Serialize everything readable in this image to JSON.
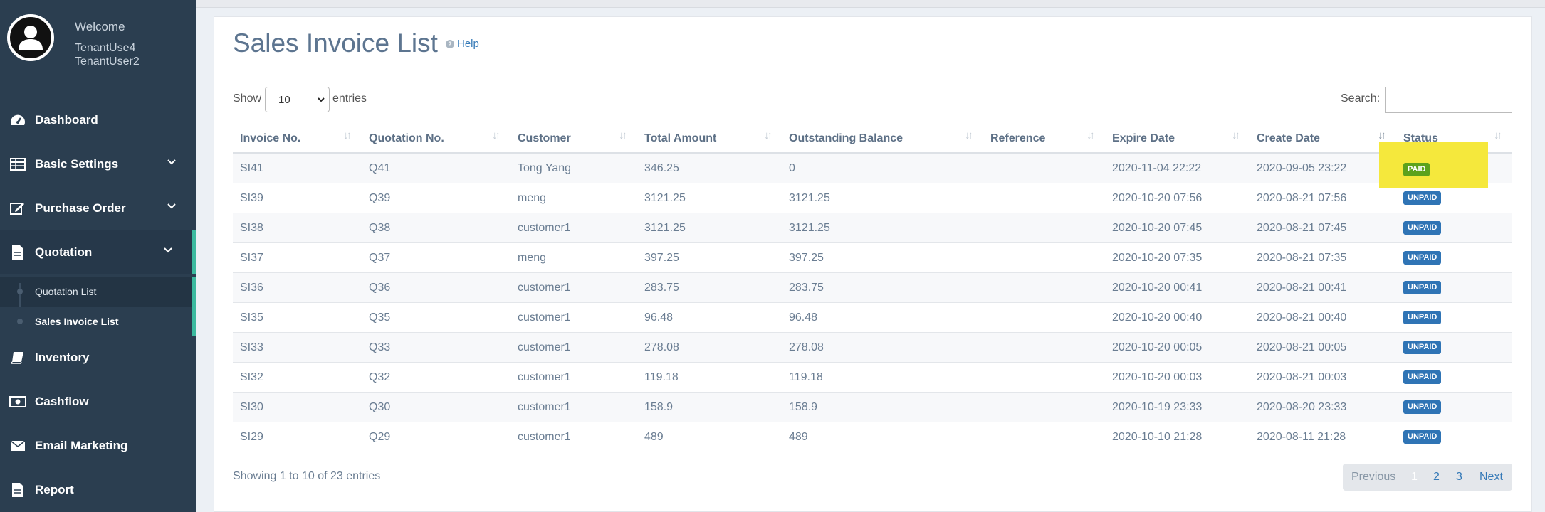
{
  "sidebar": {
    "welcome": "Welcome",
    "user_line1": "TenantUse4",
    "user_line2": "TenantUser2",
    "items": [
      {
        "label": "Dashboard",
        "icon": "dashboard-icon"
      },
      {
        "label": "Basic Settings",
        "icon": "table-icon"
      },
      {
        "label": "Purchase Order",
        "icon": "edit-icon"
      },
      {
        "label": "Quotation",
        "icon": "document-icon"
      },
      {
        "label": "Inventory",
        "icon": "book-icon"
      },
      {
        "label": "Cashflow",
        "icon": "money-icon"
      },
      {
        "label": "Email Marketing",
        "icon": "envelope-icon"
      },
      {
        "label": "Report",
        "icon": "report-icon"
      }
    ],
    "sub_items": [
      {
        "label": "Quotation List"
      },
      {
        "label": "Sales Invoice List"
      }
    ],
    "accent_color": "#3cba9f"
  },
  "page": {
    "title": "Sales Invoice List",
    "help": "Help"
  },
  "controls": {
    "show_label": "Show",
    "entries_value": "10",
    "entries_label": "entries",
    "search_label": "Search:",
    "search_value": ""
  },
  "table": {
    "columns": [
      "Invoice No.",
      "Quotation No.",
      "Customer",
      "Total Amount",
      "Outstanding Balance",
      "Reference",
      "Expire Date",
      "Create Date",
      "Status"
    ],
    "rows": [
      {
        "invoice": "SI41",
        "quotation": "Q41",
        "customer": "Tong Yang",
        "total": "346.25",
        "balance": "0",
        "reference": "",
        "expire": "2020-11-04 22:22",
        "create": "2020-09-05 23:22",
        "status": "PAID"
      },
      {
        "invoice": "SI39",
        "quotation": "Q39",
        "customer": "meng",
        "total": "3121.25",
        "balance": "3121.25",
        "reference": "",
        "expire": "2020-10-20 07:56",
        "create": "2020-08-21 07:56",
        "status": "UNPAID"
      },
      {
        "invoice": "SI38",
        "quotation": "Q38",
        "customer": "customer1",
        "total": "3121.25",
        "balance": "3121.25",
        "reference": "",
        "expire": "2020-10-20 07:45",
        "create": "2020-08-21 07:45",
        "status": "UNPAID"
      },
      {
        "invoice": "SI37",
        "quotation": "Q37",
        "customer": "meng",
        "total": "397.25",
        "balance": "397.25",
        "reference": "",
        "expire": "2020-10-20 07:35",
        "create": "2020-08-21 07:35",
        "status": "UNPAID"
      },
      {
        "invoice": "SI36",
        "quotation": "Q36",
        "customer": "customer1",
        "total": "283.75",
        "balance": "283.75",
        "reference": "",
        "expire": "2020-10-20 00:41",
        "create": "2020-08-21 00:41",
        "status": "UNPAID"
      },
      {
        "invoice": "SI35",
        "quotation": "Q35",
        "customer": "customer1",
        "total": "96.48",
        "balance": "96.48",
        "reference": "",
        "expire": "2020-10-20 00:40",
        "create": "2020-08-21 00:40",
        "status": "UNPAID"
      },
      {
        "invoice": "SI33",
        "quotation": "Q33",
        "customer": "customer1",
        "total": "278.08",
        "balance": "278.08",
        "reference": "",
        "expire": "2020-10-20 00:05",
        "create": "2020-08-21 00:05",
        "status": "UNPAID"
      },
      {
        "invoice": "SI32",
        "quotation": "Q32",
        "customer": "customer1",
        "total": "119.18",
        "balance": "119.18",
        "reference": "",
        "expire": "2020-10-20 00:03",
        "create": "2020-08-21 00:03",
        "status": "UNPAID"
      },
      {
        "invoice": "SI30",
        "quotation": "Q30",
        "customer": "customer1",
        "total": "158.9",
        "balance": "158.9",
        "reference": "",
        "expire": "2020-10-19 23:33",
        "create": "2020-08-20 23:33",
        "status": "UNPAID"
      },
      {
        "invoice": "SI29",
        "quotation": "Q29",
        "customer": "customer1",
        "total": "489",
        "balance": "489",
        "reference": "",
        "expire": "2020-10-10 21:28",
        "create": "2020-08-11 21:28",
        "status": "UNPAID"
      }
    ],
    "status_colors": {
      "PAID": "#5ca21c",
      "UNPAID": "#2f74b5"
    },
    "highlight_color": "#f5e83c"
  },
  "footer": {
    "info": "Showing 1 to 10 of 23 entries",
    "previous": "Previous",
    "pages": [
      "1",
      "2",
      "3"
    ],
    "current_page": "1",
    "next": "Next"
  }
}
